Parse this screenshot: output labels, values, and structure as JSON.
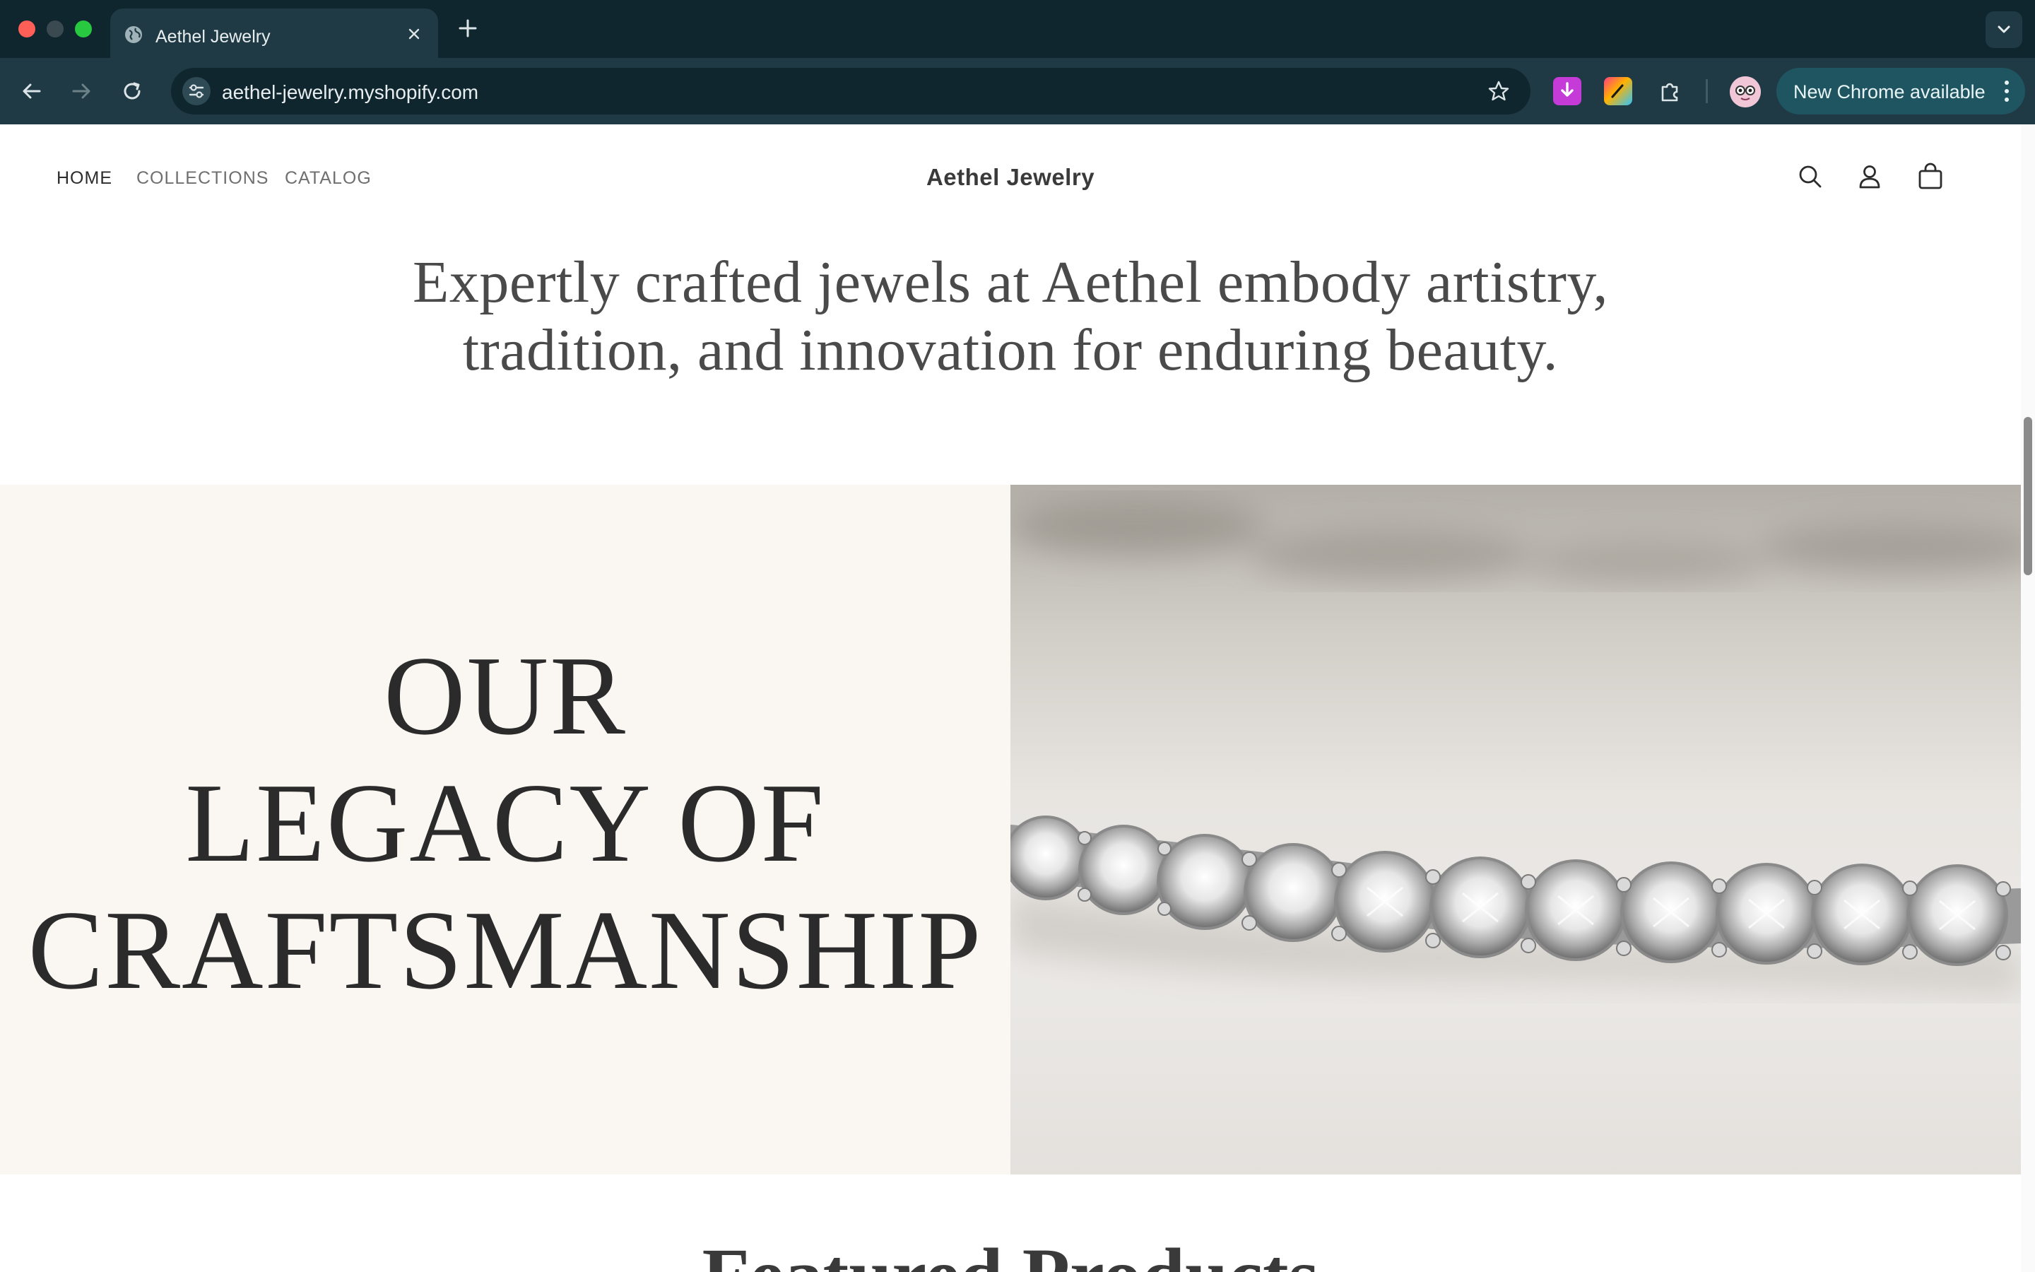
{
  "browser": {
    "tab_title": "Aethel Jewelry",
    "url": "aethel-jewelry.myshopify.com",
    "update_button": "New Chrome available"
  },
  "site": {
    "nav": [
      "HOME",
      "COLLECTIONS",
      "CATALOG"
    ],
    "brand": "Aethel Jewelry"
  },
  "intro": {
    "line1": "Expertly crafted jewels at Aethel embody artistry,",
    "line2": "tradition, and innovation for enduring beauty."
  },
  "legacy": {
    "line1": "OUR",
    "line2": "LEGACY OF",
    "line3": "CRAFTSMANSHIP"
  },
  "featured": {
    "title": "Featured Products"
  },
  "icons": {
    "tab": "globe-icon",
    "header": [
      "search-icon",
      "account-icon",
      "cart-icon"
    ]
  }
}
